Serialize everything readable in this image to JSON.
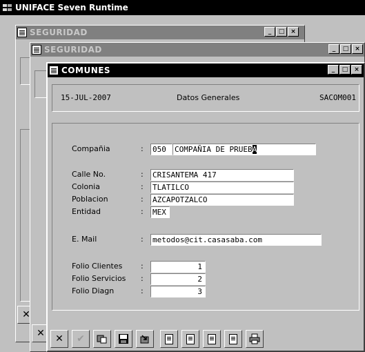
{
  "app": {
    "title": "UNIFACE Seven Runtime"
  },
  "windows": {
    "back1": {
      "title": "SEGURIDAD",
      "controls": [
        "_",
        "□",
        "×"
      ]
    },
    "back2": {
      "title": "SEGURIDAD",
      "controls": [
        "_",
        "□",
        "×"
      ]
    },
    "main": {
      "title": "COMUNES",
      "controls": [
        "_",
        "□",
        "×"
      ]
    }
  },
  "header": {
    "date": "15-JUL-2007",
    "section": "Datos Generales",
    "code": "SACOM001"
  },
  "form": {
    "compania": {
      "label": "Compañia",
      "code": "050",
      "name_pre": "COMPAÑIA DE PRUEB",
      "name_caret": "A"
    },
    "calle": {
      "label": "Calle No.",
      "value": "CRISANTEMA 417"
    },
    "colonia": {
      "label": "Colonia",
      "value": "TLATILCO"
    },
    "poblacion": {
      "label": "Poblacion",
      "value": "AZCAPOTZALCO"
    },
    "entidad": {
      "label": "Entidad",
      "value": "MEX"
    },
    "email": {
      "label": "E. Mail",
      "value": "metodos@cit.casasaba.com"
    },
    "folio_clientes": {
      "label": "Folio Clientes",
      "value": "1"
    },
    "folio_servicios": {
      "label": "Folio Servicios",
      "value": "2"
    },
    "folio_diagn": {
      "label": "Folio Diagn",
      "value": "3"
    },
    "colon": ":"
  },
  "toolbar": {
    "buttons": [
      {
        "icon": "close-x-icon",
        "glyph": "✕",
        "enabled": true
      },
      {
        "icon": "check-icon",
        "glyph": "✔",
        "enabled": false
      },
      {
        "icon": "form-icon",
        "glyph": "▟",
        "enabled": true
      },
      {
        "icon": "save-disk-icon",
        "glyph": "💾",
        "enabled": true
      },
      {
        "icon": "retrieve-icon",
        "glyph": "⇲",
        "enabled": true
      },
      {
        "icon": "insert-record-icon",
        "enabled": true
      },
      {
        "icon": "delete-record-icon",
        "enabled": true
      },
      {
        "icon": "previous-record-icon",
        "enabled": true
      },
      {
        "icon": "next-record-icon",
        "enabled": true
      },
      {
        "icon": "print-icon",
        "glyph": "⎙",
        "enabled": true
      }
    ],
    "back_buttons": [
      "✕",
      "✕"
    ]
  }
}
